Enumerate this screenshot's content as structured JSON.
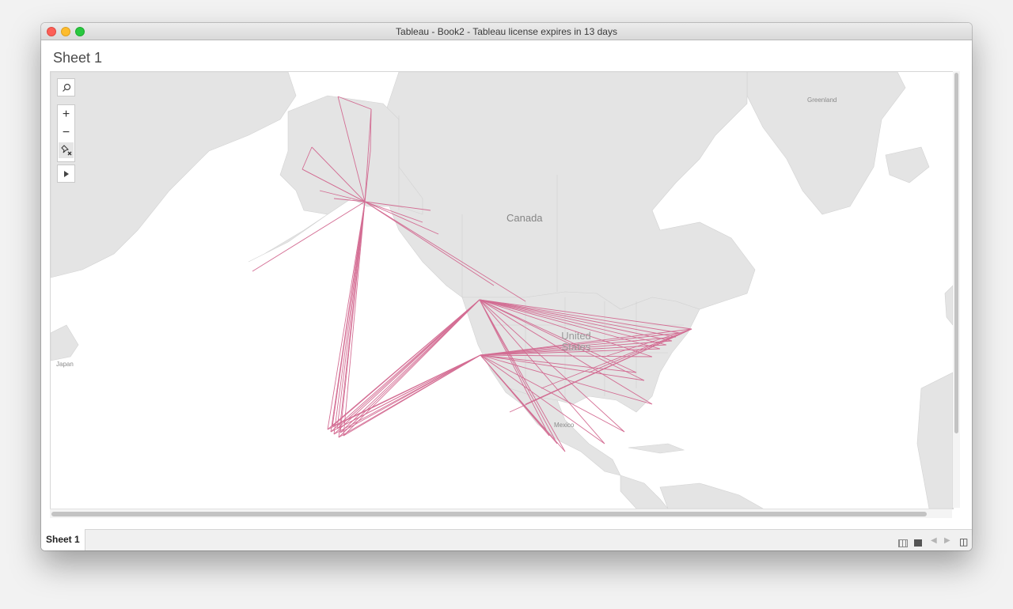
{
  "window": {
    "title": "Tableau - Book2 - Tableau license expires in 13 days"
  },
  "sheet": {
    "title": "Sheet 1"
  },
  "map": {
    "labels": {
      "canada": "Canada",
      "united_states_line1": "United",
      "united_states_line2": "States",
      "mexico": "Mexico",
      "greenland": "Greenland",
      "japan": "Japan"
    },
    "route_color": "#d2678f",
    "land_color": "#e4e4e4",
    "water_color": "#ffffff"
  },
  "map_tools": {
    "search": "search-icon",
    "zoom_in": "+",
    "zoom_out": "−",
    "pin": "pin-icon",
    "toolbar_toggle": "play-icon"
  },
  "tabs": [
    {
      "label": "Sheet 1",
      "active": true
    }
  ],
  "statusbar_icons": [
    "grid-view-icon",
    "single-view-icon",
    "prev-icon",
    "next-icon",
    "presentation-icon"
  ]
}
